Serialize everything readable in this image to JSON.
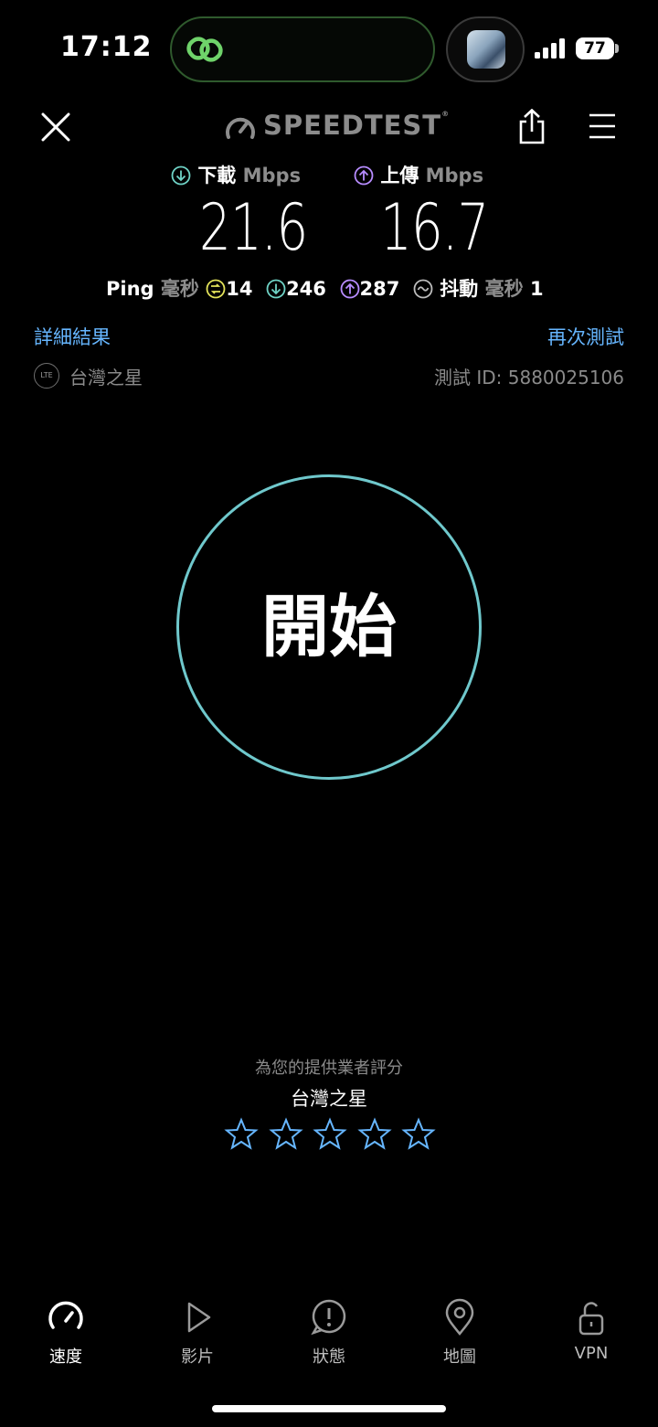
{
  "status_bar": {
    "time": "17:12",
    "battery": "77",
    "accent_island": "#6fd36a"
  },
  "header": {
    "logo_text": "SPEEDTEST",
    "logo_mark": "®"
  },
  "results": {
    "download_label": "下載",
    "upload_label": "上傳",
    "unit": "Mbps",
    "download_value": "21.6",
    "upload_value": "16.7",
    "ping_label": "Ping",
    "ping_unit": "毫秒",
    "ping_idle": "14",
    "ping_download": "246",
    "ping_upload": "287",
    "jitter_label": "抖動",
    "jitter_unit": "毫秒",
    "jitter_value": "1"
  },
  "links": {
    "details": "詳細結果",
    "retest": "再次測試"
  },
  "connection": {
    "type_badge": "LTE",
    "provider": "台灣之星",
    "test_id": "測試 ID: 5880025106"
  },
  "start_button": {
    "label": "開始",
    "ring_color": "#6fc8cc"
  },
  "rating": {
    "title": "為您的提供業者評分",
    "provider": "台灣之星",
    "stars": 0,
    "max_stars": 5,
    "star_color": "#66b6ff"
  },
  "tabs": [
    {
      "label": "速度",
      "icon": "speedometer-icon",
      "active": true
    },
    {
      "label": "影片",
      "icon": "play-icon"
    },
    {
      "label": "狀態",
      "icon": "alert-icon"
    },
    {
      "label": "地圖",
      "icon": "map-pin-icon"
    },
    {
      "label": "VPN",
      "icon": "unlock-icon"
    }
  ],
  "colors": {
    "download": "#6fd3c6",
    "upload": "#b78cff",
    "ping": "#e3e35a",
    "link": "#66b6ff"
  }
}
